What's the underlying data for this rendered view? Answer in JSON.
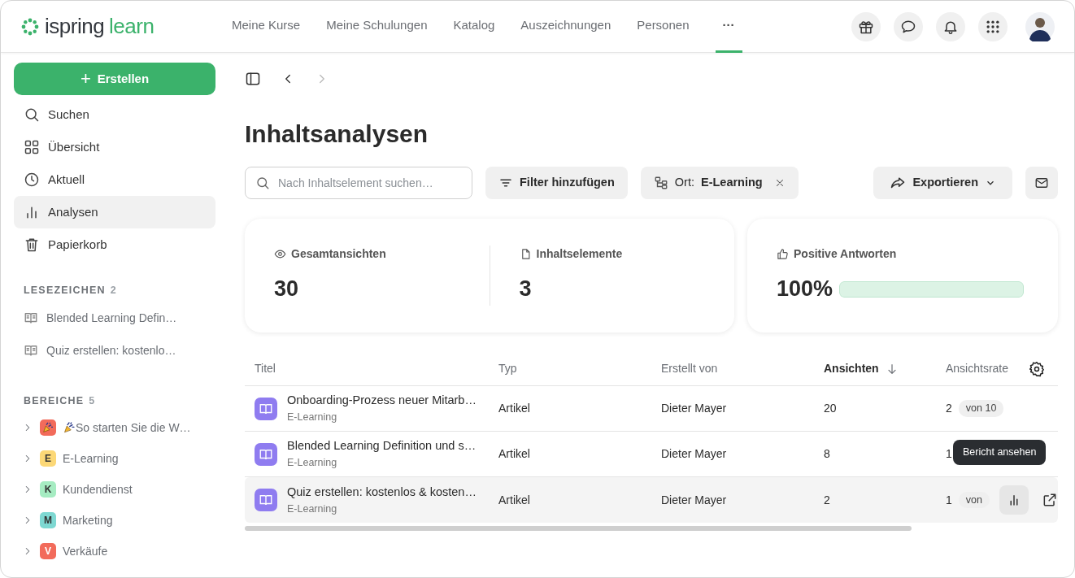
{
  "logo": {
    "word1": "ispring",
    "word2": "learn"
  },
  "nav": [
    {
      "label": "Meine Kurse",
      "selected": false
    },
    {
      "label": "Meine Schulungen",
      "selected": false
    },
    {
      "label": "Katalog",
      "selected": false
    },
    {
      "label": "Auszeichnungen",
      "selected": false
    },
    {
      "label": "Personen",
      "selected": false
    },
    {
      "label": "···",
      "selected": true
    }
  ],
  "header_actions": [
    {
      "kind": "gift"
    },
    {
      "kind": "chat"
    },
    {
      "kind": "bell"
    },
    {
      "kind": "apps"
    }
  ],
  "create_button": {
    "icon": "+",
    "label": "Erstellen"
  },
  "sidebar": {
    "items": [
      {
        "kind": "search",
        "label": "Suchen",
        "selected": false
      },
      {
        "kind": "grid",
        "label": "Übersicht",
        "selected": false
      },
      {
        "kind": "clock",
        "label": "Aktuell",
        "selected": false
      },
      {
        "kind": "chart",
        "label": "Analysen",
        "selected": true
      },
      {
        "kind": "trash",
        "label": "Papierkorb",
        "selected": false
      }
    ],
    "bookmarks": {
      "title": "LESEZEICHEN",
      "count": "2",
      "items": [
        "Blended Learning Defin…",
        "Quiz erstellen: kostenlo…"
      ]
    },
    "areas": {
      "title": "BEREICHE",
      "count": "5",
      "items": [
        {
          "kind": "emoji",
          "label": "So starten Sie die W…",
          "color": "#f26b5b"
        },
        {
          "kind": "letter",
          "letter": "E",
          "label": "E-Learning",
          "color": "#fcd877"
        },
        {
          "kind": "letter",
          "letter": "K",
          "label": "Kundendienst",
          "color": "#a6ecc2"
        },
        {
          "kind": "letter",
          "letter": "M",
          "label": "Marketing",
          "color": "#7ed8d2"
        },
        {
          "kind": "letter",
          "letter": "V",
          "label": "Verkäufe",
          "color": "#f26b5b"
        }
      ]
    }
  },
  "page_title": "Inhaltsanalysen",
  "search": {
    "placeholder": "Nach Inhaltselement suchen…"
  },
  "filter_button": "Filter hinzufügen",
  "location_chip": {
    "label": "Ort:",
    "value": "E-Learning"
  },
  "export_button": "Exportieren",
  "stats": [
    {
      "kind": "eye",
      "label": "Gesamtansichten",
      "value": "30"
    },
    {
      "kind": "file",
      "label": "Inhaltselemente",
      "value": "3"
    }
  ],
  "positive": {
    "label": "Positive Antworten",
    "value": "100%",
    "level": 1.0
  },
  "table": {
    "columns": [
      {
        "label": "Titel",
        "sorted": false
      },
      {
        "label": "Typ",
        "sorted": false
      },
      {
        "label": "Erstellt von",
        "sorted": false
      },
      {
        "label": "Ansichten",
        "sorted": true
      },
      {
        "label": "Ansichtsrate",
        "sorted": false
      }
    ],
    "rows": [
      {
        "title": "Onboarding-Prozess neuer Mitarb…",
        "area": "E-Learning",
        "type": "Artikel",
        "author": "Dieter Mayer",
        "views": "20",
        "rate": "2",
        "rate_badge": "von 10",
        "hovered": false
      },
      {
        "title": "Blended Learning Definition und s…",
        "area": "E-Learning",
        "type": "Artikel",
        "author": "Dieter Mayer",
        "views": "8",
        "rate": "1",
        "hovered": false
      },
      {
        "title": "Quiz erstellen: kostenlos & kosten…",
        "area": "E-Learning",
        "type": "Artikel",
        "author": "Dieter Mayer",
        "views": "2",
        "rate": "1",
        "rate_badge": "von",
        "hovered": true,
        "tooltip": "Bericht ansehen"
      }
    ]
  }
}
